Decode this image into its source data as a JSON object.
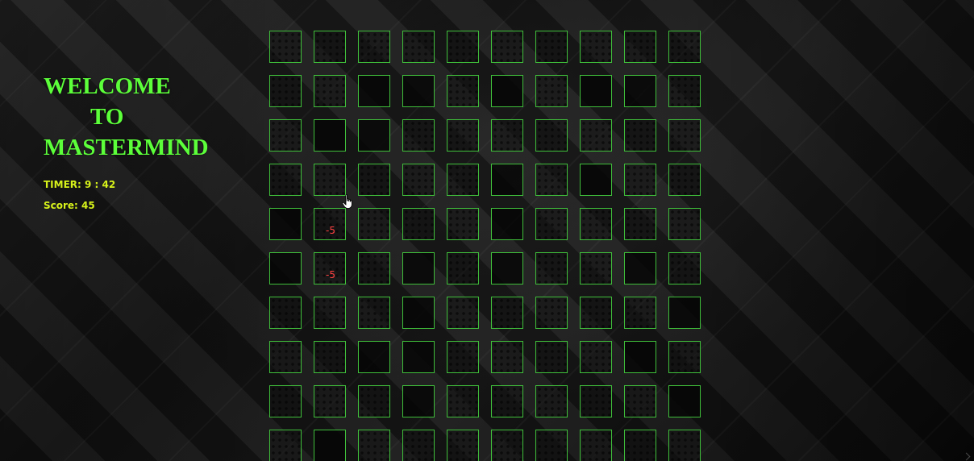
{
  "game": {
    "title_line1": "WELCOME",
    "title_line2": "TO",
    "title_line3": "MASTERMIND",
    "timer_text": "TIMER: 9 : 42",
    "score_text": "Score: 45"
  },
  "board": {
    "rows": 10,
    "cols": 10,
    "penalty_text": "-5",
    "penalty_cells": [
      [
        4,
        1
      ],
      [
        5,
        1
      ]
    ],
    "dark_cells": [
      [
        1,
        2
      ],
      [
        1,
        3
      ],
      [
        1,
        5
      ],
      [
        1,
        7
      ],
      [
        1,
        8
      ],
      [
        2,
        1
      ],
      [
        2,
        2
      ],
      [
        3,
        5
      ],
      [
        3,
        7
      ],
      [
        4,
        0
      ],
      [
        4,
        5
      ],
      [
        5,
        0
      ],
      [
        5,
        3
      ],
      [
        5,
        5
      ],
      [
        5,
        8
      ],
      [
        6,
        3
      ],
      [
        6,
        9
      ],
      [
        7,
        2
      ],
      [
        7,
        3
      ],
      [
        7,
        8
      ],
      [
        8,
        3
      ],
      [
        8,
        9
      ],
      [
        9,
        1
      ]
    ]
  },
  "colors": {
    "title": "#5cff3a",
    "stats": "#d7f21a",
    "tile_border": "#3fbf3a",
    "penalty": "#ff4040"
  },
  "icons": {
    "cursor": "hand-pointer-icon"
  }
}
